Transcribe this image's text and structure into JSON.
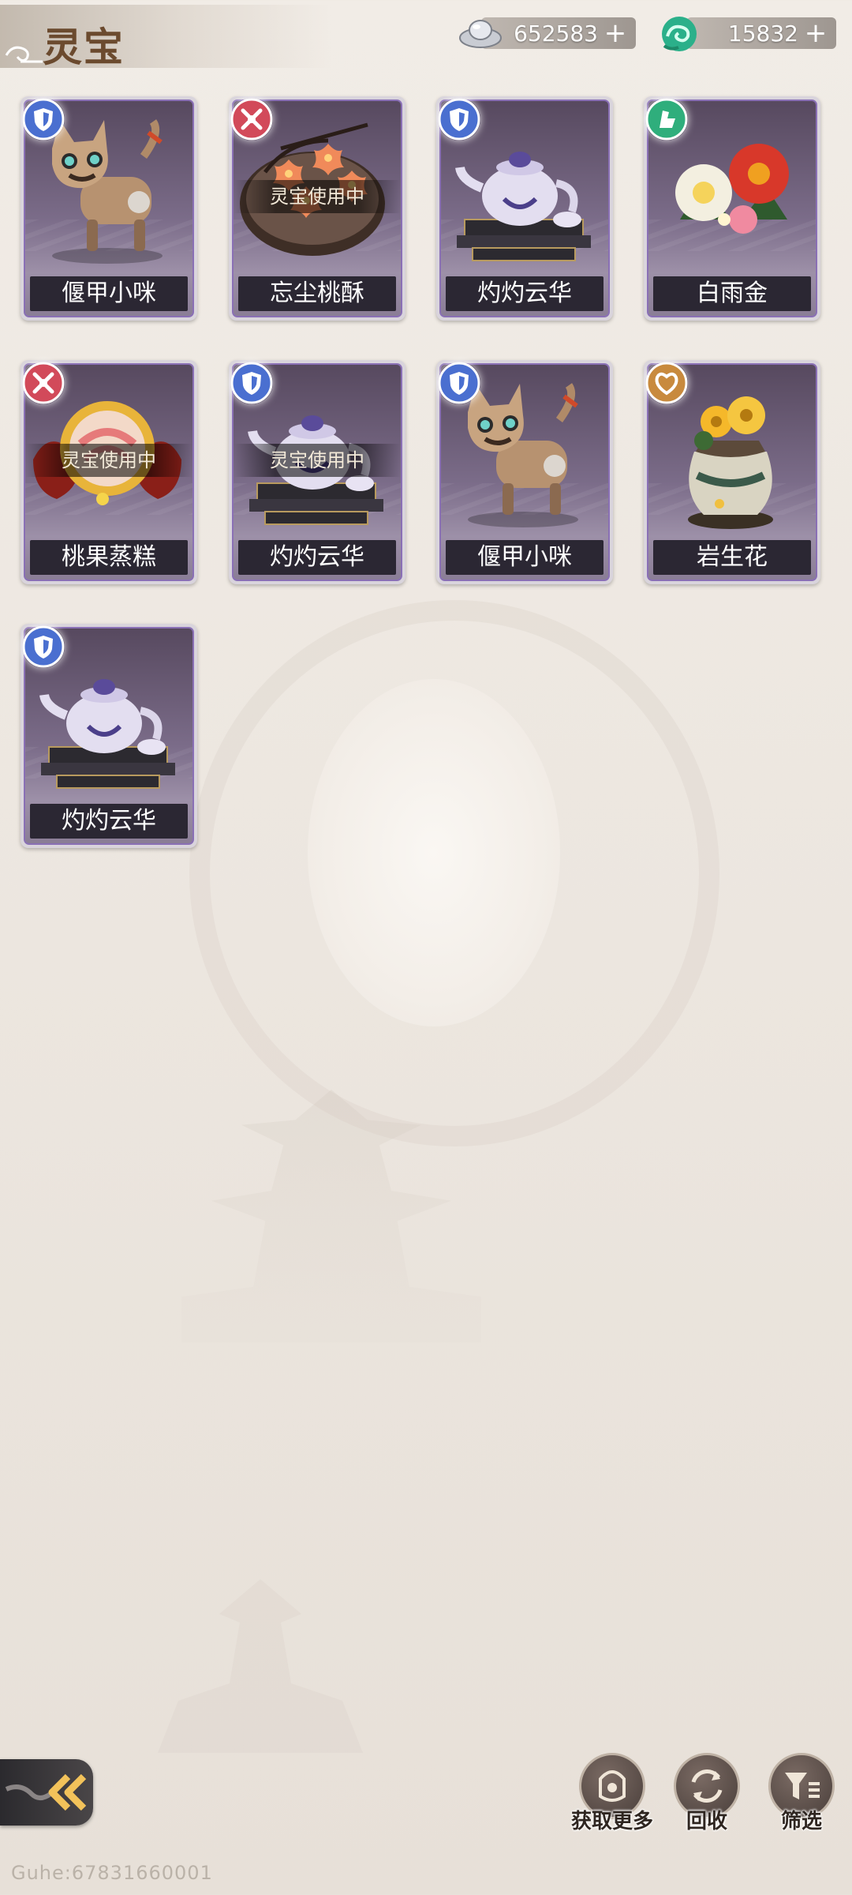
{
  "header": {
    "title": "灵宝",
    "currencies": [
      {
        "name": "silver-ingot",
        "amount": "652583"
      },
      {
        "name": "jade-cloud",
        "amount": "15832"
      }
    ],
    "plus_symbol": "+"
  },
  "items": [
    {
      "name": "偃甲小咪",
      "badge": "shield",
      "badge_color": "#4a6fd0",
      "art": "mechanical-cat",
      "in_use": ""
    },
    {
      "name": "忘尘桃酥",
      "badge": "cross-swords",
      "badge_color": "#d24a5a",
      "art": "peach-pastry",
      "in_use": "灵宝使用中"
    },
    {
      "name": "灼灼云华",
      "badge": "shield",
      "badge_color": "#4a6fd0",
      "art": "porcelain-teapot",
      "in_use": ""
    },
    {
      "name": "白雨金",
      "badge": "strength",
      "badge_color": "#2fae7c",
      "art": "camellia-flowers",
      "in_use": ""
    },
    {
      "name": "桃果蒸糕",
      "badge": "cross-swords",
      "badge_color": "#d24a5a",
      "art": "steamed-cake",
      "in_use": "灵宝使用中"
    },
    {
      "name": "灼灼云华",
      "badge": "shield",
      "badge_color": "#4a6fd0",
      "art": "porcelain-teapot",
      "in_use": "灵宝使用中"
    },
    {
      "name": "偃甲小咪",
      "badge": "shield",
      "badge_color": "#4a6fd0",
      "art": "mechanical-cat",
      "in_use": ""
    },
    {
      "name": "岩生花",
      "badge": "heart",
      "badge_color": "#c88a3e",
      "art": "rock-flower-bag",
      "in_use": ""
    },
    {
      "name": "灼灼云华",
      "badge": "shield",
      "badge_color": "#4a6fd0",
      "art": "porcelain-teapot",
      "in_use": ""
    }
  ],
  "actions": [
    {
      "label": "获取更多",
      "icon": "lantern-icon"
    },
    {
      "label": "回收",
      "icon": "recycle-icon"
    },
    {
      "label": "筛选",
      "icon": "filter-icon"
    }
  ],
  "watermark": "Guhe:67831660001"
}
